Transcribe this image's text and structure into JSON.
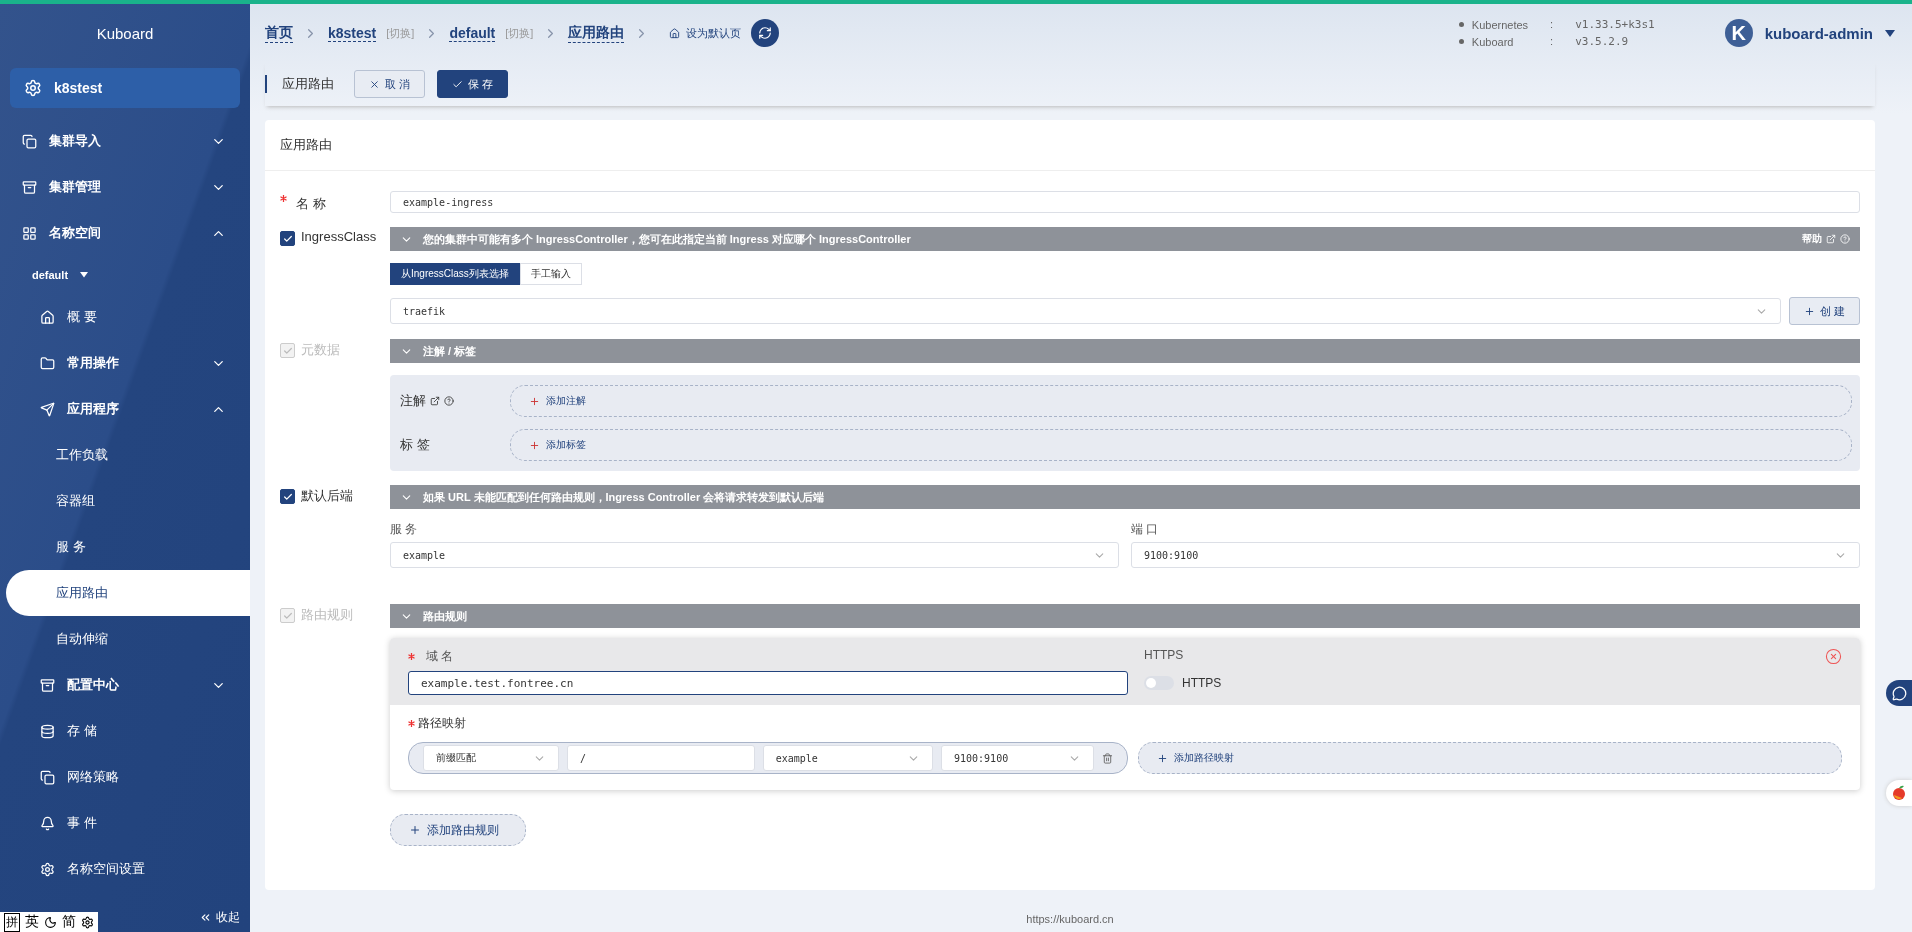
{
  "sidebar": {
    "title": "Kuboard",
    "cluster": "k8stest",
    "items": [
      {
        "kind": "group",
        "label": "集群导入",
        "expanded": false
      },
      {
        "kind": "group",
        "label": "集群管理",
        "expanded": false
      },
      {
        "kind": "group",
        "label": "名称空间",
        "expanded": true,
        "children": [
          {
            "kind": "namespace",
            "label": "default"
          },
          {
            "kind": "link",
            "label": "概 要"
          },
          {
            "kind": "group",
            "label": "常用操作",
            "expanded": false
          },
          {
            "kind": "group",
            "label": "应用程序",
            "expanded": true,
            "children": [
              {
                "kind": "sub",
                "label": "工作负载",
                "selected": false
              },
              {
                "kind": "sub",
                "label": "容器组",
                "selected": false
              },
              {
                "kind": "sub",
                "label": "服 务",
                "selected": false
              },
              {
                "kind": "sub",
                "label": "应用路由",
                "selected": true
              },
              {
                "kind": "sub",
                "label": "自动伸缩",
                "selected": false
              }
            ]
          },
          {
            "kind": "group",
            "label": "配置中心",
            "expanded": false
          },
          {
            "kind": "link",
            "label": "存 储"
          },
          {
            "kind": "link",
            "label": "网络策略"
          },
          {
            "kind": "link",
            "label": "事 件"
          },
          {
            "kind": "link",
            "label": "名称空间设置"
          }
        ]
      }
    ],
    "collapse": "收起"
  },
  "ime_toolbar": [
    "拼",
    "英",
    "简"
  ],
  "header": {
    "breadcrumbs": [
      {
        "label": "首页"
      },
      {
        "label": "k8stest",
        "switch": "[切换]"
      },
      {
        "label": "default",
        "switch": "[切换]"
      },
      {
        "label": "应用路由"
      }
    ],
    "set_default": "设为默认页",
    "versions": [
      {
        "name": "Kubernetes",
        "separator": ":",
        "value": "v1.33.5+k3s1"
      },
      {
        "name": "Kuboard",
        "separator": ":",
        "value": "v3.5.2.9"
      }
    ],
    "user": {
      "initial": "K",
      "name": "kuboard-admin"
    }
  },
  "toolbar": {
    "title": "应用路由",
    "cancel": "取 消",
    "save": "保 存"
  },
  "card": {
    "title": "应用路由",
    "name": {
      "label": "名 称",
      "required": true,
      "value": "example-ingress"
    },
    "ingress_class": {
      "label": "IngressClass",
      "checked": true,
      "disabled": false,
      "banner": "您的集群中可能有多个 IngressController，您可在此指定当前 Ingress 对应哪个 IngressController",
      "help": "帮助",
      "tabs": [
        {
          "label": "从IngressClass列表选择",
          "selected": true
        },
        {
          "label": "手工输入",
          "selected": false
        }
      ],
      "select": "traefik",
      "create_button": "创 建"
    },
    "metadata": {
      "label": "元数据",
      "checked": true,
      "disabled": true,
      "banner": "注解 / 标签",
      "rows": [
        {
          "kind": "annotation",
          "label": "注解",
          "button": "添加注解"
        },
        {
          "kind": "label",
          "label": "标 签",
          "button": "添加标签"
        }
      ]
    },
    "default_backend": {
      "label": "默认后端",
      "checked": true,
      "disabled": false,
      "banner": "如果 URL 未能匹配到任何路由规则，Ingress Controller 会将请求转发到默认后端",
      "service_label": "服 务",
      "service": "example",
      "port_label": "端 口",
      "port": "9100:9100"
    },
    "rules": {
      "label": "路由规则",
      "checked": true,
      "disabled": true,
      "banner": "路由规则",
      "items": [
        {
          "host_required": true,
          "paths_required": true,
          "host_label": "域 名",
          "host": "example.test.fontree.cn",
          "https_label": "HTTPS",
          "https_on": false,
          "https_text": "HTTPS",
          "paths_label": "路径映射",
          "paths": [
            {
              "match": "前缀匹配",
              "path": "/",
              "service": "example",
              "port": "9100:9100"
            }
          ],
          "add_path": "添加路径映射"
        }
      ],
      "add_rule": "添加路由规则"
    }
  },
  "footer": "https://kuboard.cn"
}
